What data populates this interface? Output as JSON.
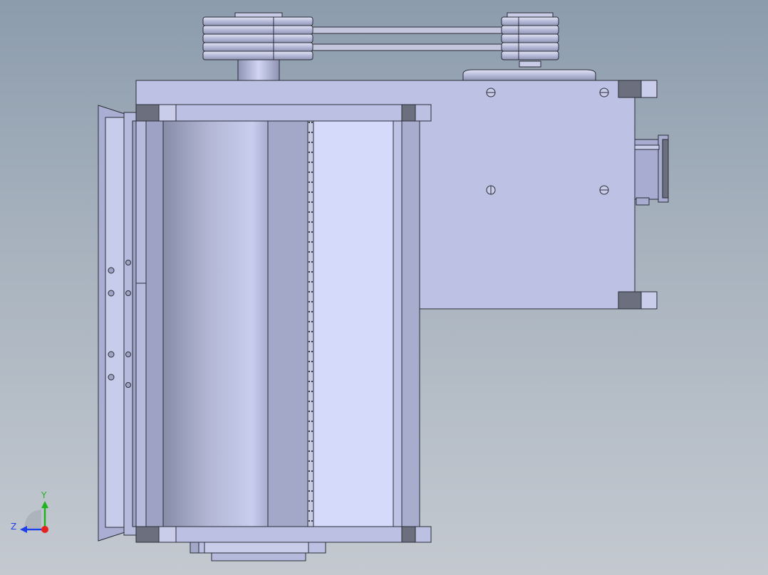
{
  "viewport": {
    "colors": {
      "background_top": "#8c9cad",
      "background_bottom": "#c4c9d0",
      "part_light": "#bcc3e6",
      "part_mid": "#a3a8c8",
      "part_dark": "#6b6f7e",
      "outline": "#2a2c36",
      "screen_face": "#d5d9fa"
    }
  },
  "triad": {
    "y_label": "Y",
    "z_label": "Z",
    "y_color": "#1fb31f",
    "z_color": "#1f3fe6",
    "x_color": "#e61f1f"
  }
}
